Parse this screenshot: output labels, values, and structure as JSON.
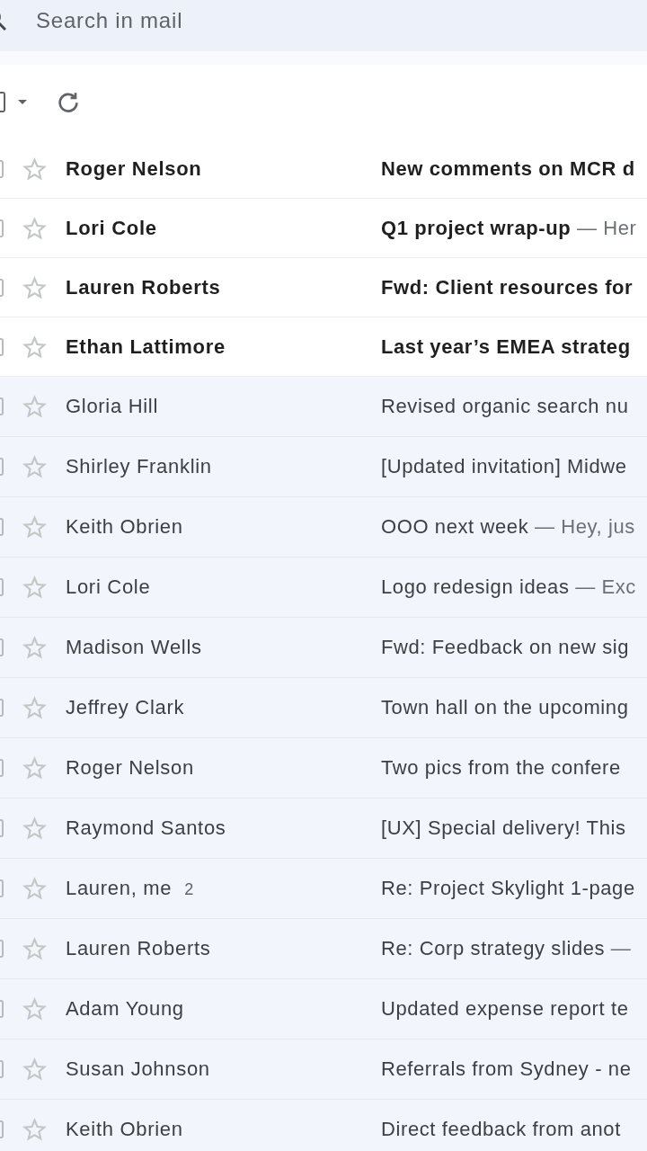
{
  "search": {
    "placeholder": "Search in mail"
  },
  "toolbar": {
    "select_all": {
      "checked": false
    }
  },
  "rows": [
    {
      "sender": "Roger Nelson",
      "subject": "New comments on MCR d",
      "unread": true,
      "starred": false,
      "checked": false
    },
    {
      "sender": "Lori Cole",
      "subject": "Q1 project wrap-up",
      "snippet": "— Her",
      "unread": true,
      "starred": false,
      "checked": false
    },
    {
      "sender": "Lauren Roberts",
      "subject": "Fwd: Client resources for",
      "unread": true,
      "starred": false,
      "checked": false
    },
    {
      "sender": "Ethan Lattimore",
      "subject": "Last year’s EMEA strateg",
      "unread": true,
      "starred": false,
      "checked": false
    },
    {
      "sender": "Gloria Hill",
      "subject": "Revised organic search nu",
      "unread": false,
      "starred": false,
      "checked": false
    },
    {
      "sender": "Shirley Franklin",
      "subject": "[Updated invitation] Midwe",
      "unread": false,
      "starred": false,
      "checked": false
    },
    {
      "sender": "Keith Obrien",
      "subject": "OOO next week",
      "snippet": "— Hey, jus",
      "unread": false,
      "starred": false,
      "checked": false
    },
    {
      "sender": "Lori Cole",
      "subject": "Logo redesign ideas",
      "snippet": "— Exc",
      "unread": false,
      "starred": false,
      "checked": false
    },
    {
      "sender": "Madison Wells",
      "subject": "Fwd: Feedback on new sig",
      "unread": false,
      "starred": false,
      "checked": false
    },
    {
      "sender": "Jeffrey Clark",
      "subject": "Town hall on the upcoming",
      "unread": false,
      "starred": false,
      "checked": false
    },
    {
      "sender": "Roger Nelson",
      "subject": "Two pics from the confere",
      "unread": false,
      "starred": false,
      "checked": false
    },
    {
      "sender": "Raymond Santos",
      "subject": "[UX] Special delivery! This",
      "unread": false,
      "starred": false,
      "checked": false
    },
    {
      "sender": "Lauren, me",
      "count": "2",
      "subject": "Re: Project Skylight 1-page",
      "unread": false,
      "starred": false,
      "checked": false
    },
    {
      "sender": "Lauren Roberts",
      "subject": "Re: Corp strategy slides",
      "snippet": "—",
      "unread": false,
      "starred": false,
      "checked": false
    },
    {
      "sender": "Adam Young",
      "subject": "Updated expense report te",
      "unread": false,
      "starred": false,
      "checked": false
    },
    {
      "sender": "Susan Johnson",
      "subject": "Referrals from Sydney - ne",
      "unread": false,
      "starred": false,
      "checked": false
    },
    {
      "sender": "Keith Obrien",
      "subject": "Direct feedback from anot",
      "unread": false,
      "starred": false,
      "checked": false
    }
  ]
}
